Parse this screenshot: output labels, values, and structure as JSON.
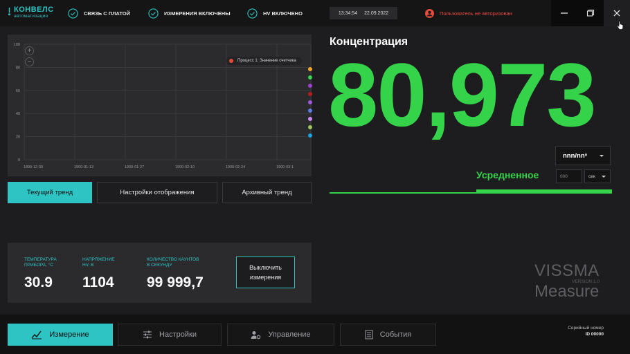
{
  "topbar": {
    "logo_name": "КОНВЕЛС",
    "logo_sub": "автоматизация",
    "statuses": [
      "СВЯЗЬ С ПЛАТОЙ",
      "ИЗМЕРЕНИЯ ВКЛЮЧЕНЫ",
      "HV ВКЛЮЧЕНО"
    ],
    "time": "13:34:54",
    "date": "22.09.2022",
    "user_status": "Пользователь не авторизован"
  },
  "chart_data": {
    "type": "line",
    "y_ticks": [
      "100",
      "80",
      "60",
      "40",
      "20",
      "0"
    ],
    "x_ticks": [
      "1899-12-30",
      "1900-01-13",
      "1900-01-27",
      "1900-02-10",
      "1900-02-24",
      "1900-03-1"
    ],
    "ylim": [
      0,
      100
    ],
    "grid": true,
    "legend_placement": "top-right",
    "series": [
      {
        "name": "Процесс 1: Значение счетчика",
        "values": []
      }
    ],
    "series_colors": [
      "#e84a3c",
      "#f5a623",
      "#34d34a",
      "#9b3fd1",
      "#b51d1d",
      "#9b59d6",
      "#5b7fe0",
      "#c98cf2",
      "#a6c25b",
      "#17a2d8"
    ]
  },
  "chart_controls": {
    "zoom_in": "+",
    "zoom_out": "−"
  },
  "tabs": [
    "Текущий тренд",
    "Настройки отображения",
    "Архивный тренд"
  ],
  "info": {
    "temp_label": "ТЕМПЕРАТУРА\nПРИБОРА, °C",
    "temp_value": "30.9",
    "voltage_label": "НАПРЯЖЕНИЕ\nHV, В",
    "voltage_value": "1104",
    "counts_label": "КОЛИЧЕСТВО КАУНТОВ\nВ СЕКУНДУ",
    "counts_value": "99 999,7",
    "stop_button": "Выключить измерения"
  },
  "concentration": {
    "title": "Концентрация",
    "value": "80,973",
    "unit": "nnn/nnⁿ",
    "averaged_label": "Усредненное",
    "avg_placeholder": "000",
    "avg_unit": "сек"
  },
  "brand": {
    "top": "VISSMA",
    "version": "VERSION 1.0",
    "bottom": "Measure"
  },
  "nav": [
    "Измерение",
    "Настройки",
    "Управление",
    "События"
  ],
  "serial": {
    "label": "Серийный номер",
    "value": "ID 00000"
  },
  "colors": {
    "accent": "#2ec4c4",
    "value_green": "#34d34a",
    "alert": "#e84a3c"
  }
}
